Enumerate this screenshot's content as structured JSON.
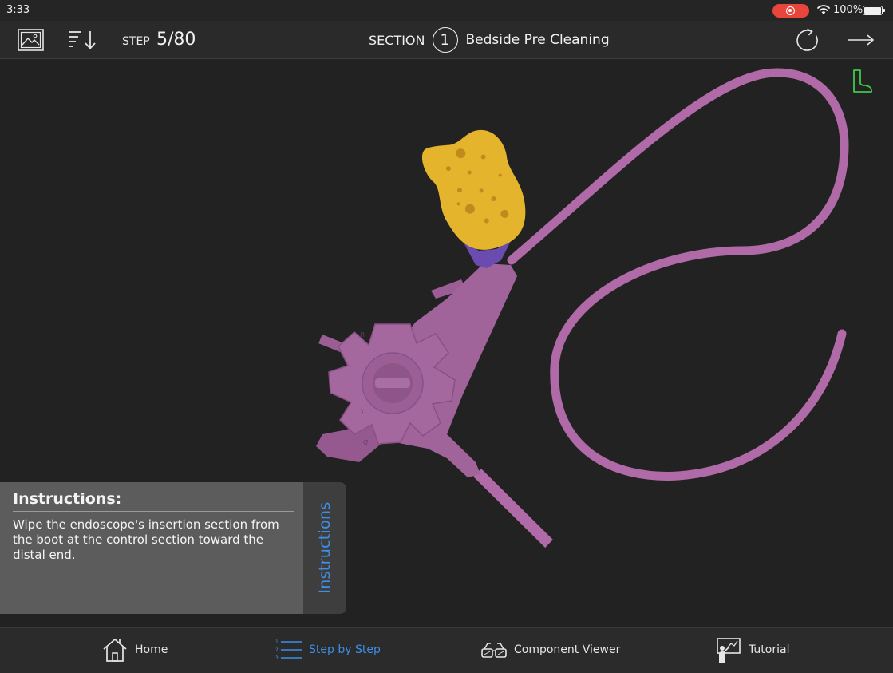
{
  "status_bar": {
    "time": "3:33",
    "battery_percent": "100%",
    "battery_level": 1.0,
    "recording": true,
    "icons": [
      "record-icon",
      "wifi-icon",
      "battery-icon"
    ]
  },
  "toolbar": {
    "step_prefix": "STEP",
    "step_count": "5/80",
    "section_word": "SECTION",
    "section_number": "1",
    "section_title": "Bedside Pre Cleaning",
    "icons": [
      "image-gallery-icon",
      "sort-steps-icon",
      "rotate-icon",
      "next-arrow-icon",
      "boot-icon"
    ]
  },
  "instructions": {
    "title": "Instructions:",
    "body": "Wipe the endoscope's insertion section from the boot at the control section toward the distal end.",
    "tab_label": "Instructions"
  },
  "tabs": [
    {
      "label": "Home",
      "icon": "home-icon",
      "active": false
    },
    {
      "label": "Step by Step",
      "icon": "numbered-list-icon",
      "active": true
    },
    {
      "label": "Component Viewer",
      "icon": "3d-glasses-icon",
      "active": false
    },
    {
      "label": "Tutorial",
      "icon": "presentation-icon",
      "active": false
    }
  ],
  "colors": {
    "background": "#222222",
    "accent_blue": "#3d8fe8",
    "endoscope_purple": "#a0649b",
    "tube_purple": "#b06aa8",
    "sponge_yellow": "#e4b42c",
    "boot_indicator_green": "#3ec84a",
    "record_red": "#e8453c"
  }
}
